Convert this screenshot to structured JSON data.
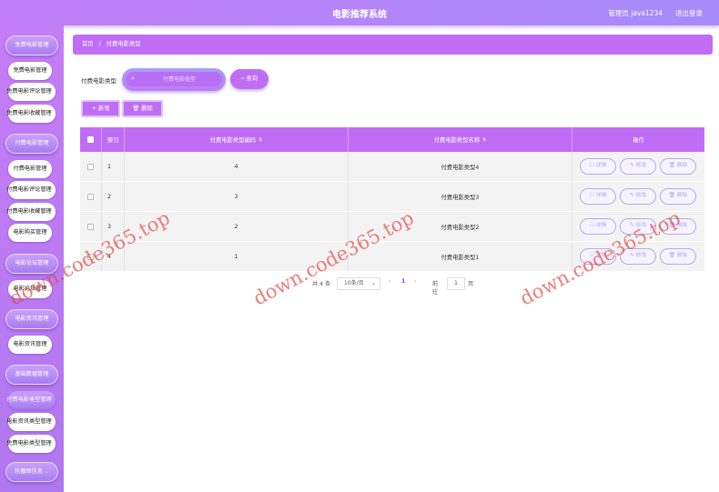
{
  "header": {
    "title": "电影推荐系统",
    "user": "管理员 java1234",
    "logout": "退出登录"
  },
  "sidebar": {
    "groups": [
      {
        "label": "免费电影管理",
        "items": [
          "免费电影管理",
          "免费电影评论管理",
          "免费电影收藏管理"
        ]
      },
      {
        "label": "付费电影管理",
        "items": [
          "付费电影管理",
          "付费电影评论管理",
          "付费电影收藏管理",
          "电影购买管理"
        ]
      },
      {
        "label": "电影论坛管理",
        "items": [
          "电影论坛管理"
        ]
      },
      {
        "label": "电影资讯管理",
        "items": [
          "电影资讯管理"
        ]
      },
      {
        "label": "基础数据管理",
        "items": [
          "付费电影类型管理",
          "电影资讯类型管理",
          "免费电影类型管理"
        ]
      },
      {
        "label": "轮播图信息",
        "items": []
      }
    ]
  },
  "breadcrumb": {
    "home": "首页",
    "sep": "/",
    "current": "付费电影类型"
  },
  "search": {
    "label": "付费电影类型",
    "placeholder": "付费电影类型",
    "button": "查询"
  },
  "actions": {
    "add": "+ 新增",
    "delete": "删除"
  },
  "table": {
    "headers": {
      "index": "索引",
      "code": "付费电影类型编码",
      "name": "付费电影类型名称",
      "op": "操作"
    },
    "rows": [
      {
        "index": "1",
        "code": "4",
        "name": "付费电影类型4"
      },
      {
        "index": "2",
        "code": "3",
        "name": "付费电影类型3"
      },
      {
        "index": "3",
        "code": "2",
        "name": "付费电影类型2"
      },
      {
        "index": "4",
        "code": "1",
        "name": "付费电影类型1"
      }
    ],
    "ops": {
      "detail": "详情",
      "edit": "修改",
      "delete": "删除"
    }
  },
  "pagination": {
    "total": "共 4 条",
    "page_size": "10条/页",
    "current_page": "1",
    "goto_label": "前往",
    "goto_value": "1",
    "page_suffix": "页"
  },
  "watermarks": [
    "down.code365.top",
    "down.code365.top",
    "down.code365.top"
  ],
  "colors": {
    "primary": "#c06df6",
    "header": "#c17ef6",
    "op_border": "#b0a8f2"
  }
}
